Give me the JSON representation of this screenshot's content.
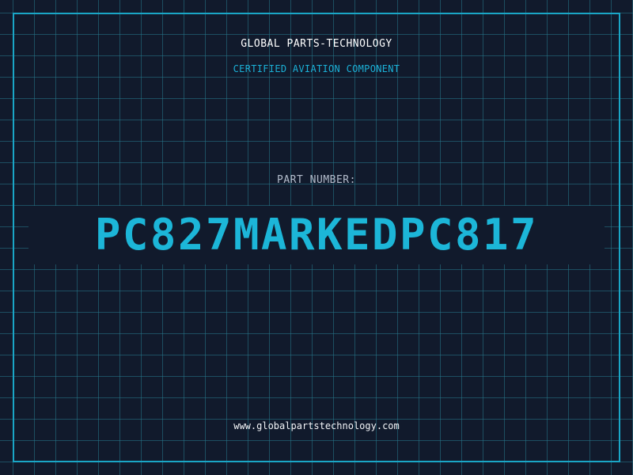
{
  "header": {
    "brand": "GLOBAL PARTS-TECHNOLOGY",
    "tagline": "CERTIFIED AVIATION COMPONENT"
  },
  "part": {
    "label": "PART NUMBER:",
    "number": "PC827MARKEDPC817"
  },
  "footer": {
    "website": "www.globalpartstechnology.com"
  },
  "colors": {
    "background": "#111a2c",
    "grid": "#26788c",
    "frame": "#1aa6c6",
    "accent": "#1cb6d8",
    "label": "#b3bccb",
    "text": "#ffffff"
  }
}
